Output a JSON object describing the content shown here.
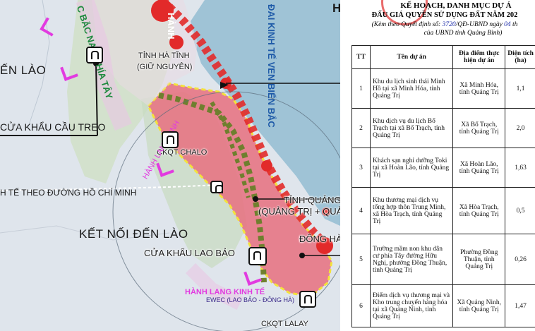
{
  "map": {
    "labels": {
      "top_letter": "H",
      "hanh_top": "HÀNH",
      "bac_nam": "C BẮC NAM PHÍA TÂY",
      "dai_kinh_te": "ĐAI KINH TẾ VEN BIỂN BẮC",
      "ha_tinh": "TỈNH HÀ TĨNH",
      "giu_nguyen": "(GIỮ NGUYÊN)",
      "den_lao": "ẾN LÀO",
      "cua_khau_cau_treo": "CỬA KHẨU CẦU TREO",
      "ckqt_chalo": "CKQT CHALO",
      "hanh_lang_kinh": "HÀNH LANG KINH",
      "kinh_te_ho_chi_minh": "H TẾ THEO ĐƯỜNG HỒ CHÍ MINH",
      "ket_noi_den_lao": "KẾT NỐI ĐẾN LÀO",
      "tinh_quang_tri": "TỈNH QUẢNG TRỊ",
      "quang_tri_quang_binh": "(QUẢNG TRỊ + QUẢNG B",
      "cua_khau_lao_bao": "CỬA KHẨU LAO BẢO",
      "dong_ha": "ĐÔNG HÀ",
      "hanh_lang_kinh_te_bottom": "HÀNH LANG KINH TẾ",
      "ewec": "EWEC (LAO BẢO - ĐÔNG HÀ)",
      "ckqt_lalay": "CKQT LALAY"
    },
    "colors": {
      "province": "#e8707f",
      "coast_red": "#e22a2a",
      "green_dash": "#6f7f2e",
      "yellow_border": "#f4e23a",
      "chevron": "#e23be0",
      "sea": "#9fc3d6"
    }
  },
  "doc": {
    "title_line1": "KẾ HOẠCH, DANH MỤC DỰ Á",
    "title_line2": "ĐẤU GIÁ QUYỀN SỬ DỤNG ĐẤT NĂM 202",
    "subtitle_prefix": "(Kèm theo Quyết định số:",
    "decision_no": "3720",
    "subtitle_mid": "/QĐ-UBND ngày",
    "day": "04",
    "subtitle_tail": "th",
    "subtitle_line2": "của UBND tỉnh Quảng Bình)",
    "table": {
      "headers": [
        "TT",
        "Tên dự án",
        "Địa điểm thực hiện dự án",
        "Diện tích (ha)"
      ],
      "rows": [
        {
          "tt": "1",
          "name": "Khu du lịch sinh thái Minh Hồ tại xã Minh Hóa, tỉnh Quảng Trị",
          "place": "Xã Minh Hóa, tỉnh Quảng Trị",
          "area": "1,1"
        },
        {
          "tt": "2",
          "name": "Khu dịch vụ du lịch Bố Trạch tại xã Bố Trạch, tỉnh Quảng Trị",
          "place": "Xã Bố Trạch, tỉnh Quảng Trị",
          "area": "2,0"
        },
        {
          "tt": "3",
          "name": "Khách sạn nghỉ dưỡng Toki tại xã Hoàn Lão, tỉnh Quảng Trị",
          "place": "Xã Hoàn Lão, tỉnh Quảng Trị",
          "area": "1,63"
        },
        {
          "tt": "4",
          "name": "Khu thương mại dịch vụ tổng hợp thôn Trung Minh, xã Hòa Trạch, tỉnh Quảng Trị",
          "place": "Xã Hòa Trạch, tỉnh Quảng Trị",
          "area": "0,5"
        },
        {
          "tt": "5",
          "name": "Trường mầm non khu dân cư phía Tây đường Hữu Nghị, phường Đồng Thuận, tỉnh Quảng Trị",
          "place": "Phường Đồng Thuận, tỉnh Quảng Trị",
          "area": "0,26"
        },
        {
          "tt": "6",
          "name": "Điểm dịch vụ thương mại và Kho trung chuyển hàng hóa tại xã Quảng Ninh, tỉnh Quảng Trị",
          "place": "Xã Quảng Ninh, tỉnh Quảng Trị",
          "area": "1,47"
        }
      ]
    }
  }
}
